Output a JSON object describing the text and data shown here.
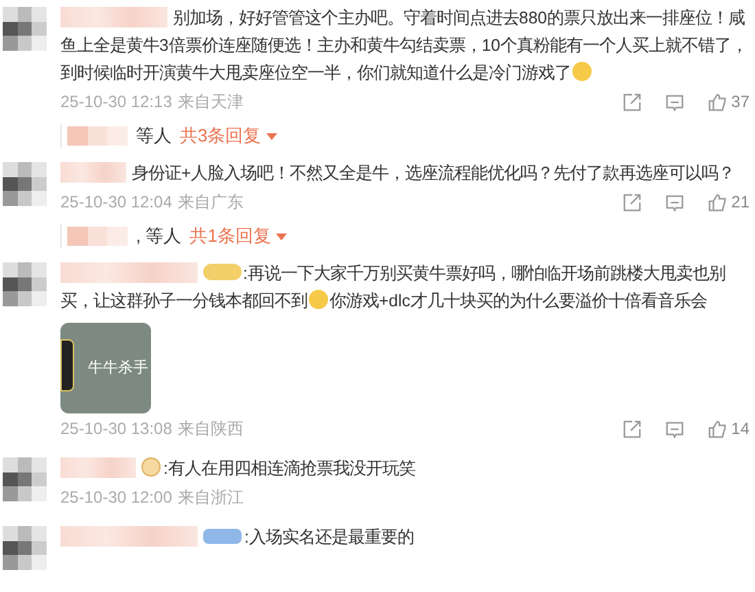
{
  "comments": [
    {
      "segments": [
        {
          "kind": "text",
          "text": "别加场，好好管管这个主办吧。守着时间点进去880的票只放出来一排座位！咸鱼上全是黄牛3倍票价连座随便选！主办和黄牛勾结卖票，10个真粉能有一个人买上就不错了，到时候临时开演黄牛大甩卖座位空一半，你们就知道什么是冷门游戏了"
        },
        {
          "kind": "emoji"
        }
      ],
      "time": "25-10-30 12:13",
      "location": "来自天津",
      "likes": "37",
      "replies": {
        "who": "等人",
        "count": "共3条回复"
      }
    },
    {
      "segments": [
        {
          "kind": "text",
          "text": "身份证+人脸入场吧！不然又全是牛，选座流程能优化吗？先付了款再选座可以吗？"
        }
      ],
      "time": "25-10-30 12:04",
      "location": "来自广东",
      "likes": "21",
      "replies": {
        "who": ", 等人",
        "count": "共1条回复"
      }
    },
    {
      "badge": {
        "kind": "gold"
      },
      "segments": [
        {
          "kind": "text",
          "text": ":再说一下大家千万别买黄牛票好吗，哪怕临开场前跳楼大甩卖也别买，让这群孙子一分钱本都回不到"
        },
        {
          "kind": "emoji"
        },
        {
          "kind": "text",
          "text": "你游戏+dlc才几十块买的为什么要溢价十倍看音乐会"
        }
      ],
      "image": {
        "caption": "牛牛杀手"
      },
      "time": "25-10-30 13:08",
      "location": "来自陕西",
      "likes": "14"
    },
    {
      "badge": {
        "kind": "crown"
      },
      "segments": [
        {
          "kind": "text",
          "text": ":有人在用四相连滴抢票我没开玩笑"
        }
      ],
      "time": "25-10-30 12:00",
      "location": "来自浙江"
    },
    {
      "badge": {
        "kind": "blue"
      },
      "segments": [
        {
          "kind": "text",
          "text": ":入场实名还是最重要的"
        }
      ]
    }
  ]
}
